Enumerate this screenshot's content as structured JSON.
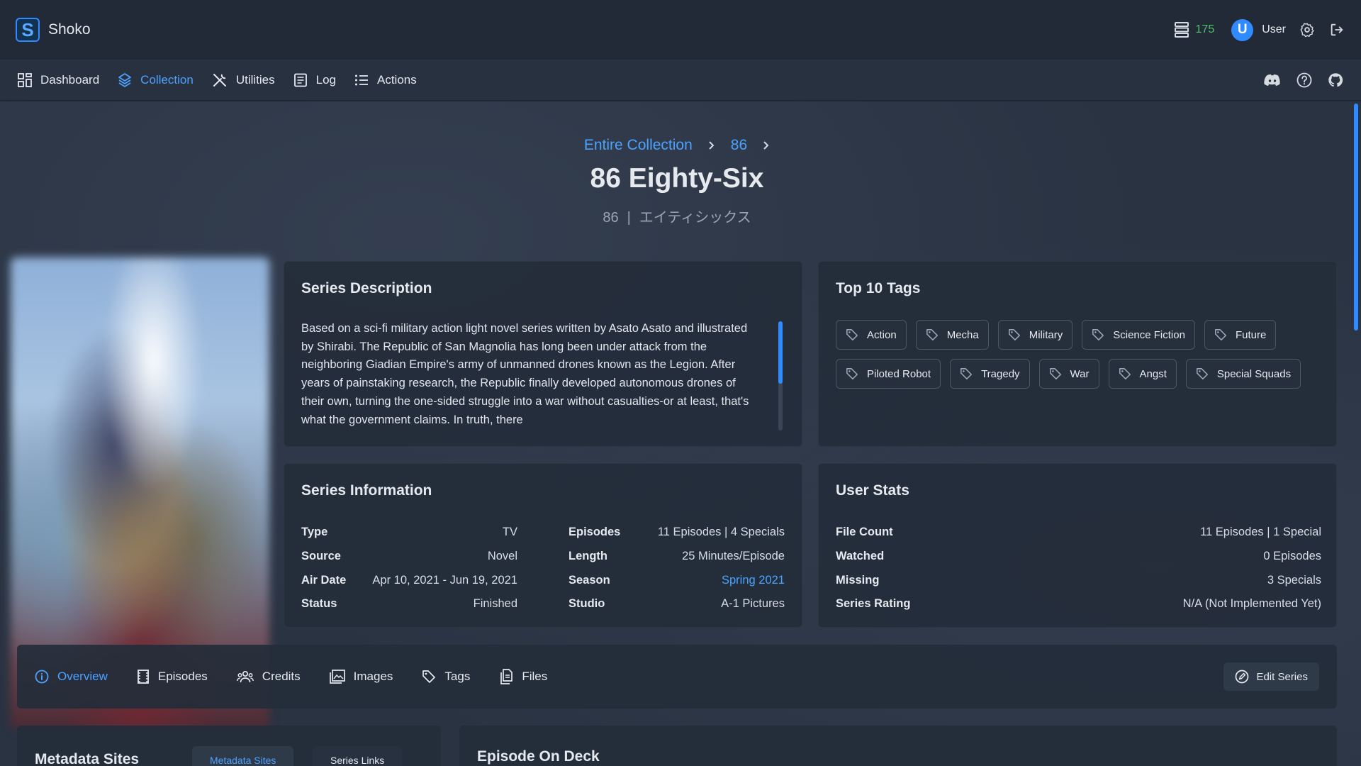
{
  "app": {
    "title": "Shoko",
    "logo_letter": "S"
  },
  "topbar": {
    "queue_count": "175",
    "user_initial": "U",
    "user_name": "User"
  },
  "nav": {
    "items": [
      {
        "label": "Dashboard",
        "icon": "dashboard-icon"
      },
      {
        "label": "Collection",
        "icon": "collection-icon",
        "active": true
      },
      {
        "label": "Utilities",
        "icon": "utilities-icon"
      },
      {
        "label": "Log",
        "icon": "log-icon"
      },
      {
        "label": "Actions",
        "icon": "actions-icon"
      }
    ],
    "right_icons": [
      "discord-icon",
      "help-icon",
      "github-icon"
    ]
  },
  "breadcrumb": {
    "root": "Entire Collection",
    "group": "86"
  },
  "series": {
    "title": "86 Eighty-Six",
    "subtitle_main": "86",
    "subtitle_sep": "|",
    "subtitle_alt": "エイティシックス"
  },
  "description": {
    "title": "Series Description",
    "text": "Based on a sci-fi military action light novel series written by Asato Asato and illustrated by Shirabi. The Republic of San Magnolia has long been under attack from the neighboring Giadian Empire's army of unmanned drones known as the Legion. After years of painstaking research, the Republic finally developed autonomous drones of their own, turning the one-sided struggle into a war without casualties-or at least, that's what the government claims. In truth, there"
  },
  "tags": {
    "title": "Top 10 Tags",
    "items": [
      "Action",
      "Mecha",
      "Military",
      "Science Fiction",
      "Future",
      "Piloted Robot",
      "Tragedy",
      "War",
      "Angst",
      "Special Squads"
    ]
  },
  "info": {
    "title": "Series Information",
    "left": [
      {
        "key": "Type",
        "value": "TV"
      },
      {
        "key": "Source",
        "value": "Novel"
      },
      {
        "key": "Air Date",
        "value": "Apr 10, 2021 - Jun 19, 2021"
      },
      {
        "key": "Status",
        "value": "Finished"
      }
    ],
    "right": [
      {
        "key": "Episodes",
        "value": "11 Episodes | 4 Specials"
      },
      {
        "key": "Length",
        "value": "25 Minutes/Episode"
      },
      {
        "key": "Season",
        "value": "Spring 2021"
      },
      {
        "key": "Studio",
        "value": "A-1 Pictures"
      }
    ]
  },
  "stats": {
    "title": "User Stats",
    "rows": [
      {
        "key": "File Count",
        "value": "11 Episodes | 1 Special"
      },
      {
        "key": "Watched",
        "value": "0 Episodes"
      },
      {
        "key": "Missing",
        "value": "3 Specials"
      },
      {
        "key": "Series Rating",
        "value": "N/A (Not Implemented Yet)"
      }
    ]
  },
  "tabs": {
    "items": [
      {
        "label": "Overview",
        "icon": "info-icon",
        "active": true
      },
      {
        "label": "Episodes",
        "icon": "film-icon"
      },
      {
        "label": "Credits",
        "icon": "people-icon"
      },
      {
        "label": "Images",
        "icon": "image-icon"
      },
      {
        "label": "Tags",
        "icon": "tag-icon"
      },
      {
        "label": "Files",
        "icon": "files-icon"
      }
    ],
    "edit_label": "Edit Series"
  },
  "metadata": {
    "title": "Metadata Sites",
    "tab_active": "Metadata Sites",
    "tab_inactive": "Series Links"
  },
  "deck": {
    "title": "Episode On Deck"
  },
  "colors": {
    "accent": "#2f8bff",
    "link": "#4ba3ff",
    "queue": "#4cc46a",
    "bg": "#283140"
  }
}
